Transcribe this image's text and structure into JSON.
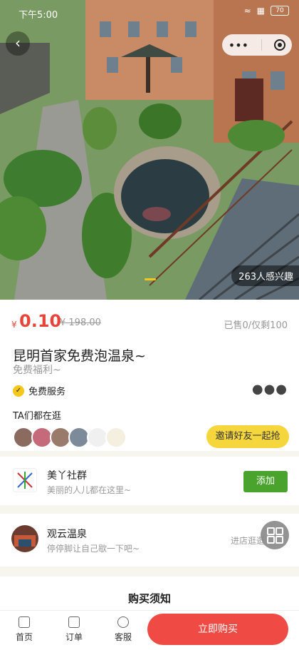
{
  "status_bar": {
    "time": "下午5:00",
    "battery": "70"
  },
  "hero": {
    "interest": "263人感兴趣"
  },
  "product": {
    "currency": "¥",
    "price": "0.10",
    "original_price": "¥ 198.00",
    "sold": "已售0/仅剩100",
    "title": "昆明首家免费泡温泉~",
    "subtitle": "免费福利~",
    "service": "免费服务"
  },
  "social": {
    "title": "TA们都在逛",
    "invite_label": "邀请好友一起抢"
  },
  "group": {
    "name": "美丫社群",
    "desc": "美丽的人儿都在这里~",
    "add_label": "添加"
  },
  "shop": {
    "name": "观云温泉",
    "desc": "停停脚让自己歇一下吧~",
    "enter_label": "进店逛逛"
  },
  "notice": {
    "title": "购买须知"
  },
  "tabs": [
    {
      "label": "首页"
    },
    {
      "label": "订单"
    },
    {
      "label": "客服"
    }
  ],
  "buy_label": "立即购买",
  "colors": {
    "accent": "#ef4b44",
    "yellow": "#f5d63d",
    "green": "#4aa32d"
  }
}
